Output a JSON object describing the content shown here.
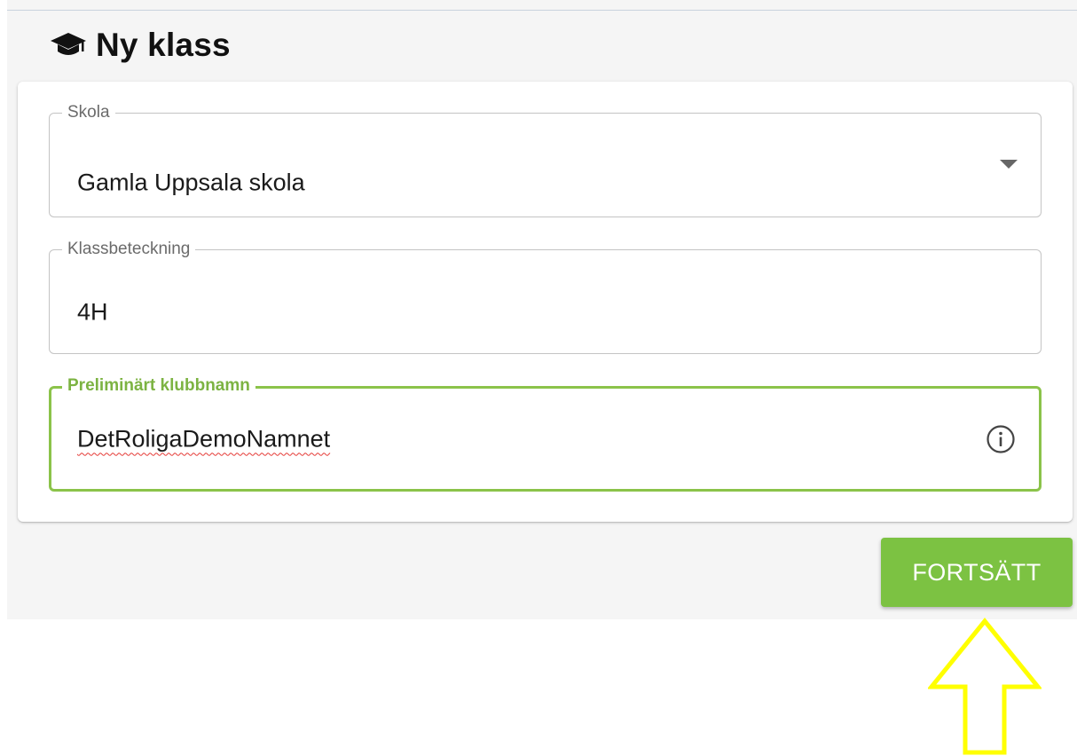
{
  "header": {
    "title": "Ny klass",
    "icon": "graduation-cap-icon"
  },
  "form": {
    "school": {
      "label": "Skola",
      "value": "Gamla Uppsala skola",
      "icon": "chevron-down-icon"
    },
    "class_designation": {
      "label": "Klassbeteckning",
      "value": "4H"
    },
    "club_name": {
      "label": "Preliminärt klubbnamn",
      "value": "DetRoligaDemoNamnet",
      "icon": "info-icon",
      "focused": true
    }
  },
  "actions": {
    "continue_label": "FORTSÄTT"
  },
  "annotation": {
    "icon": "arrow-up-icon",
    "color": "#ffff00"
  },
  "colors": {
    "accent_green": "#7cc242",
    "focus_green": "#8bc34a",
    "app_background": "#f5f5f5"
  }
}
